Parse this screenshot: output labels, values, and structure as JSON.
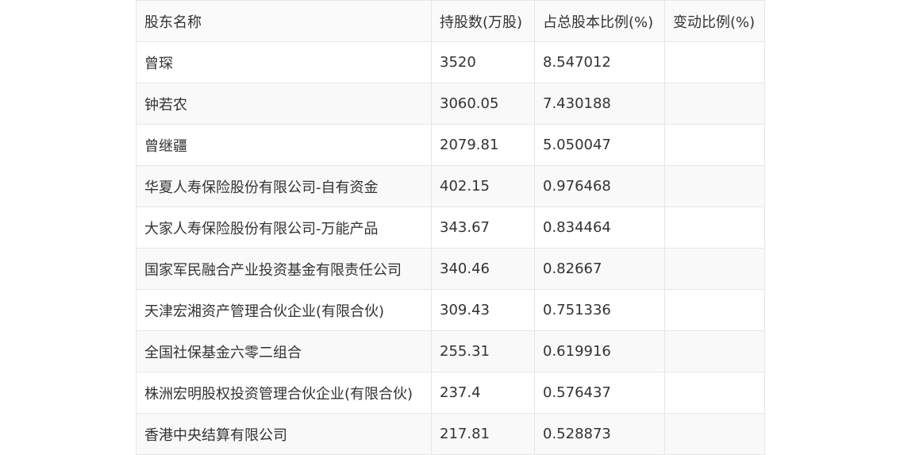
{
  "table": {
    "headers": [
      "股东名称",
      "持股数(万股)",
      "占总股本比例(%)",
      "变动比例(%)"
    ],
    "rows": [
      {
        "name": "曾琛",
        "shares": "3520",
        "ratio": "8.547012",
        "change": ""
      },
      {
        "name": "钟若农",
        "shares": "3060.05",
        "ratio": "7.430188",
        "change": ""
      },
      {
        "name": "曾继疆",
        "shares": "2079.81",
        "ratio": "5.050047",
        "change": ""
      },
      {
        "name": "华夏人寿保险股份有限公司-自有资金",
        "shares": "402.15",
        "ratio": "0.976468",
        "change": ""
      },
      {
        "name": "大家人寿保险股份有限公司-万能产品",
        "shares": "343.67",
        "ratio": "0.834464",
        "change": ""
      },
      {
        "name": "国家军民融合产业投资基金有限责任公司",
        "shares": "340.46",
        "ratio": "0.82667",
        "change": ""
      },
      {
        "name": "天津宏湘资产管理合伙企业(有限合伙)",
        "shares": "309.43",
        "ratio": "0.751336",
        "change": ""
      },
      {
        "name": "全国社保基金六零二组合",
        "shares": "255.31",
        "ratio": "0.619916",
        "change": ""
      },
      {
        "name": "株洲宏明股权投资管理合伙企业(有限合伙)",
        "shares": "237.4",
        "ratio": "0.576437",
        "change": ""
      },
      {
        "name": "香港中央结算有限公司",
        "shares": "217.81",
        "ratio": "0.528873",
        "change": ""
      }
    ]
  }
}
